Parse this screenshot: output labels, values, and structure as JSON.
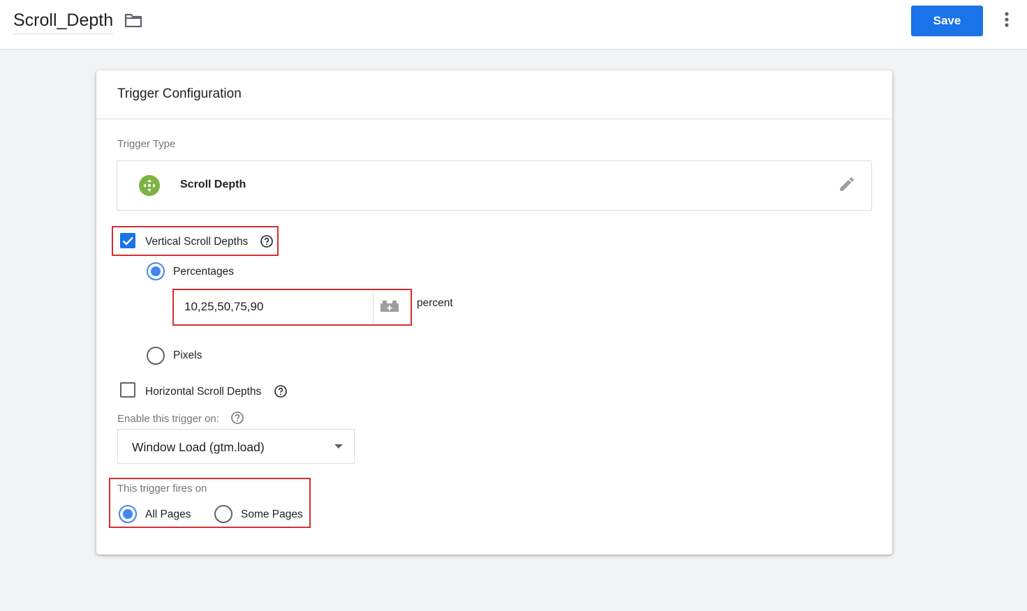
{
  "header": {
    "title": "Scroll_Depth",
    "save_label": "Save",
    "accent_color": "#1a73e8"
  },
  "card": {
    "title": "Trigger Configuration",
    "trigger_type_label": "Trigger Type",
    "trigger_type_name": "Scroll Depth",
    "trigger_icon_color": "#7cb342",
    "vertical": {
      "label": "Vertical Scroll Depths",
      "checked": true,
      "options": {
        "percentages": "Percentages",
        "pixels": "Pixels"
      },
      "selected": "percentages",
      "value": "10,25,50,75,90",
      "unit": "percent"
    },
    "horizontal": {
      "label": "Horizontal Scroll Depths",
      "checked": false
    },
    "enable_on": {
      "label": "Enable this trigger on:",
      "value": "Window Load (gtm.load)"
    },
    "fires_on": {
      "label": "This trigger fires on",
      "options": [
        "All Pages",
        "Some Pages"
      ],
      "selected": "All Pages"
    }
  },
  "icons": [
    "folder-icon",
    "more-vert-icon",
    "scroll-depth-icon",
    "edit-pencil-icon",
    "check-icon",
    "help-icon",
    "variable-brick-icon",
    "dropdown-arrow-icon"
  ],
  "highlight_color": "#d32f2f"
}
